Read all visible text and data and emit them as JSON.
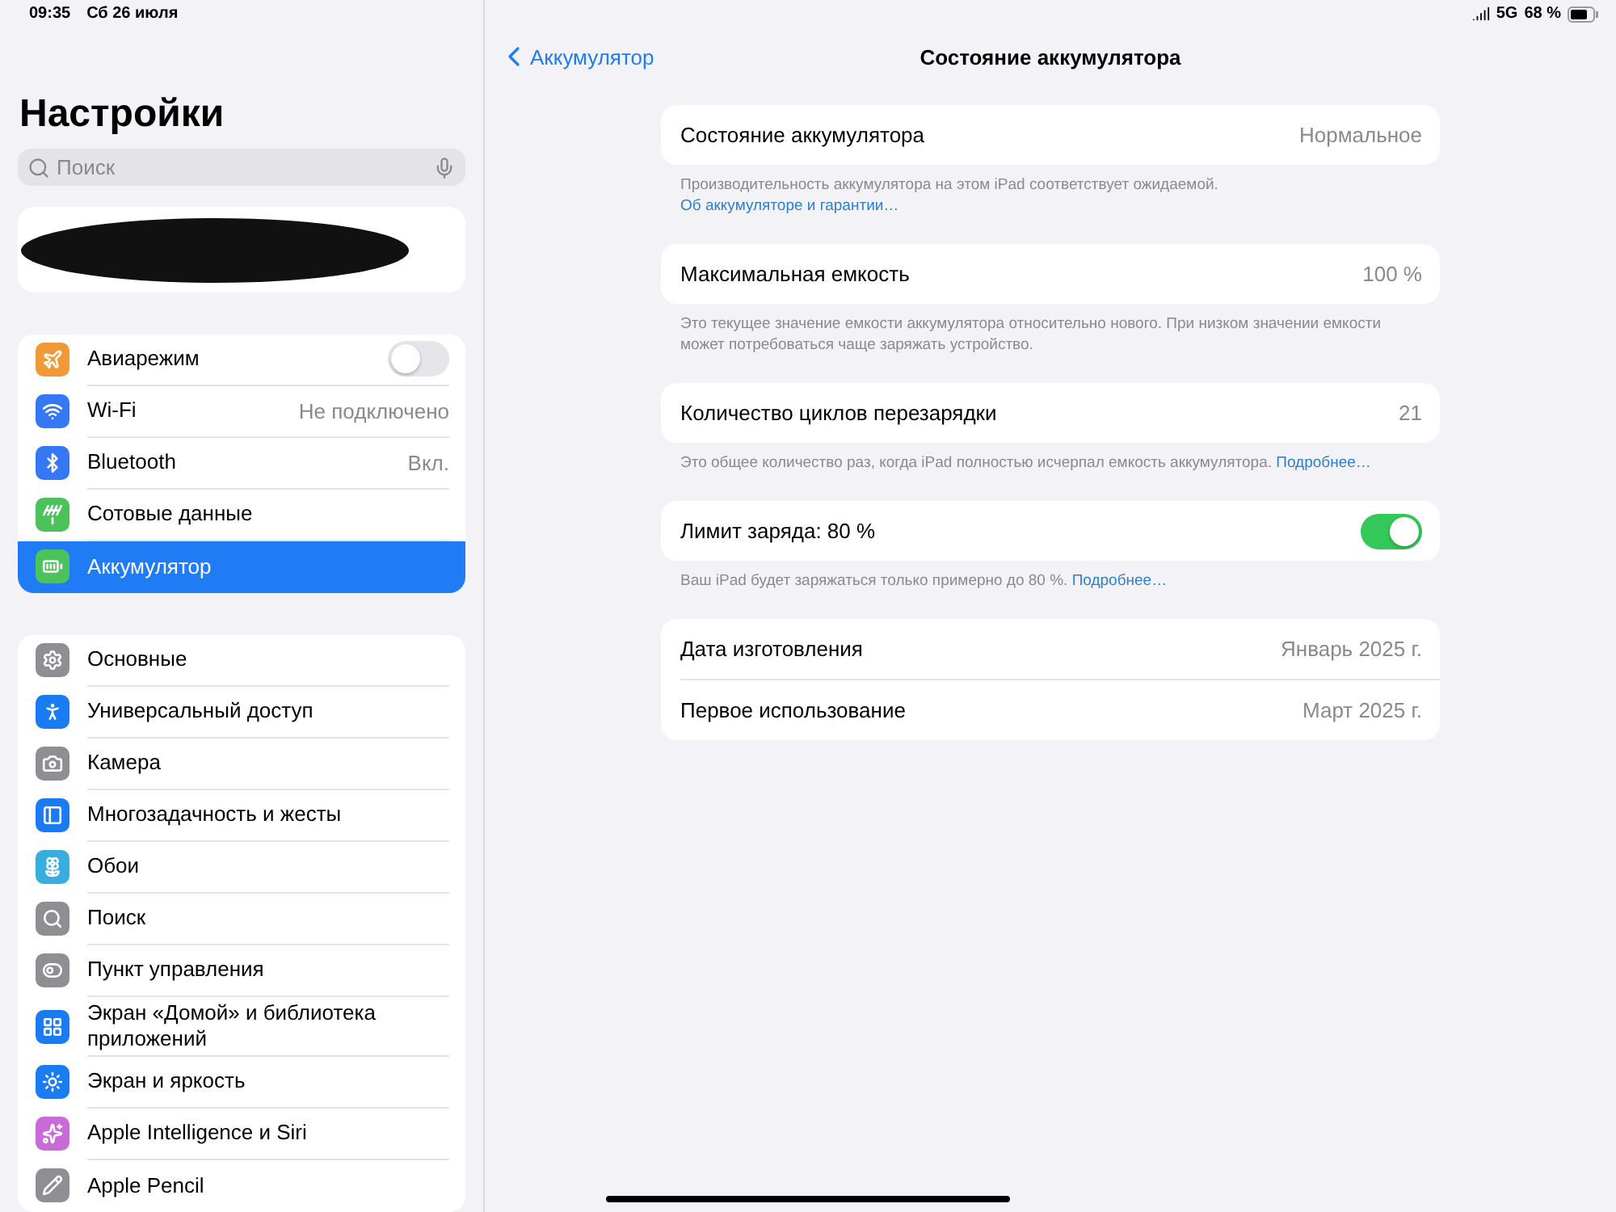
{
  "status_bar": {
    "time": "09:35",
    "date": "Сб 26 июля",
    "network": "5G",
    "battery": "68 %"
  },
  "sidebar": {
    "title": "Настройки",
    "search": {
      "placeholder": "Поиск"
    },
    "groups": [
      {
        "items": [
          {
            "label": "Авиарежим",
            "color": "#f09a37",
            "kind": "toggle",
            "on": false,
            "selected": false
          },
          {
            "label": "Wi-Fi",
            "color": "#3478f6",
            "kind": "value",
            "value": "Не подключено",
            "selected": false
          },
          {
            "label": "Bluetooth",
            "color": "#3478f6",
            "kind": "value",
            "value": "Вкл.",
            "selected": false
          },
          {
            "label": "Сотовые данные",
            "color": "#4cc35a",
            "kind": "plain",
            "selected": false
          },
          {
            "label": "Аккумулятор",
            "color": "#4cc35a",
            "kind": "plain",
            "selected": true
          }
        ]
      },
      {
        "items": [
          {
            "label": "Основные",
            "color": "#8e8e93",
            "kind": "plain",
            "selected": false
          },
          {
            "label": "Универсальный доступ",
            "color": "#1a7cf5",
            "kind": "plain",
            "selected": false
          },
          {
            "label": "Камера",
            "color": "#8e8e93",
            "kind": "plain",
            "selected": false
          },
          {
            "label": "Многозадачность и жесты",
            "color": "#1a7cf5",
            "kind": "plain",
            "selected": false
          },
          {
            "label": "Обои",
            "color": "#38aee0",
            "kind": "plain",
            "selected": false
          },
          {
            "label": "Поиск",
            "color": "#8e8e93",
            "kind": "plain",
            "selected": false
          },
          {
            "label": "Пункт управления",
            "color": "#8e8e93",
            "kind": "plain",
            "selected": false
          },
          {
            "label": "Экран «Домой» и библиотека приложений",
            "color": "#1a7cf5",
            "kind": "plain",
            "selected": false
          },
          {
            "label": "Экран и яркость",
            "color": "#1a7cf5",
            "kind": "plain",
            "selected": false
          },
          {
            "label": "Apple Intelligence и Siri",
            "color": "#c86bd8",
            "kind": "plain",
            "selected": false
          },
          {
            "label": "Apple Pencil",
            "color": "#8e8e93",
            "kind": "plain",
            "selected": false
          }
        ]
      }
    ]
  },
  "detail": {
    "back": "Аккумулятор",
    "title": "Состояние аккумулятора",
    "sections": [
      {
        "rows": [
          {
            "kind": "value",
            "label": "Состояние аккумулятора",
            "value": "Нормальное"
          }
        ],
        "footer": {
          "text": "Производительность аккумулятора на этом iPad соответствует ожидаемой.",
          "link": "Об аккумуляторе и гарантии…"
        }
      },
      {
        "rows": [
          {
            "kind": "value",
            "label": "Максимальная емкость",
            "value": "100 %"
          }
        ],
        "footer": {
          "text": "Это текущее значение емкости аккумулятора относительно нового. При низком значении емкости может потребоваться чаще заряжать устройство."
        }
      },
      {
        "rows": [
          {
            "kind": "value",
            "label": "Количество циклов перезарядки",
            "value": "21"
          }
        ],
        "footer": {
          "text": "Это общее количество раз, когда iPad полностью исчерпал емкость аккумулятора.",
          "link": "Подробнее…"
        }
      },
      {
        "rows": [
          {
            "kind": "toggle",
            "label": "Лимит заряда: 80 %",
            "on": true
          }
        ],
        "footer": {
          "text": "Ваш iPad будет заряжаться только примерно до 80 %.",
          "link": "Подробнее…"
        }
      },
      {
        "rows": [
          {
            "kind": "value",
            "label": "Дата изготовления",
            "value": "Январь 2025 г."
          },
          {
            "kind": "value",
            "label": "Первое использование",
            "value": "Март 2025 г."
          }
        ]
      }
    ]
  }
}
